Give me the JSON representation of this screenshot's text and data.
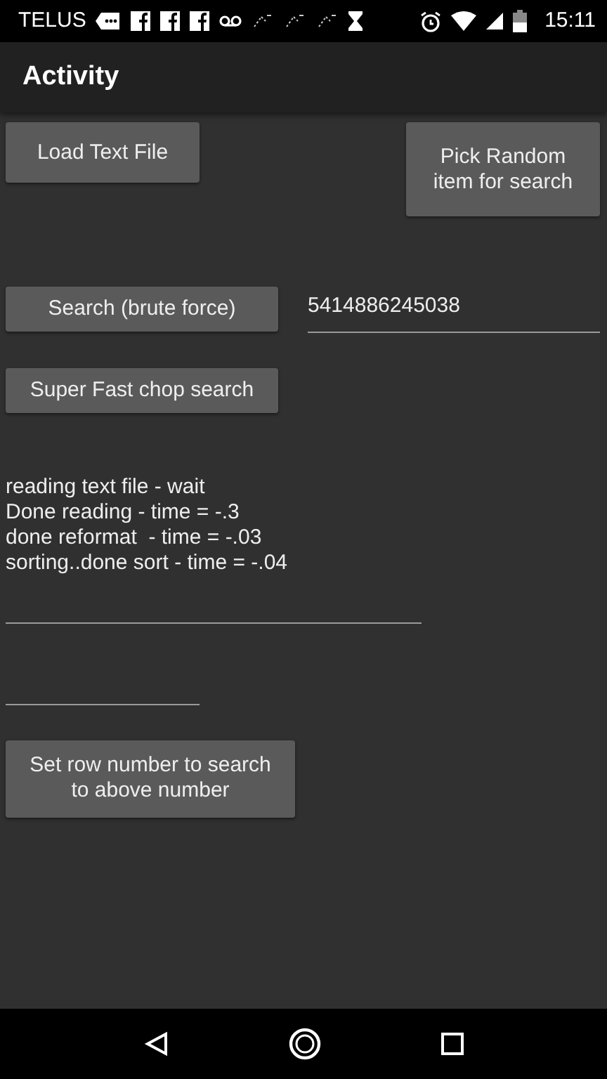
{
  "status_bar": {
    "carrier": "TELUS",
    "time": "15:11"
  },
  "app_bar": {
    "title": "Activity"
  },
  "buttons_top": [
    {
      "label": "Load Text File"
    },
    {
      "label": "Pick Random item for search"
    }
  ],
  "search_button": {
    "label": "Search (brute force)"
  },
  "search_field": {
    "value": "5414886245038"
  },
  "chop_button": {
    "label": "Super Fast chop search"
  },
  "log_lines": [
    "reading text file - wait",
    "Done reading - time = -.3",
    "done reformat  - time = -.03",
    "sorting..done sort - time = -.04"
  ],
  "set_row_button": {
    "label": "Set row number to search to above number"
  }
}
